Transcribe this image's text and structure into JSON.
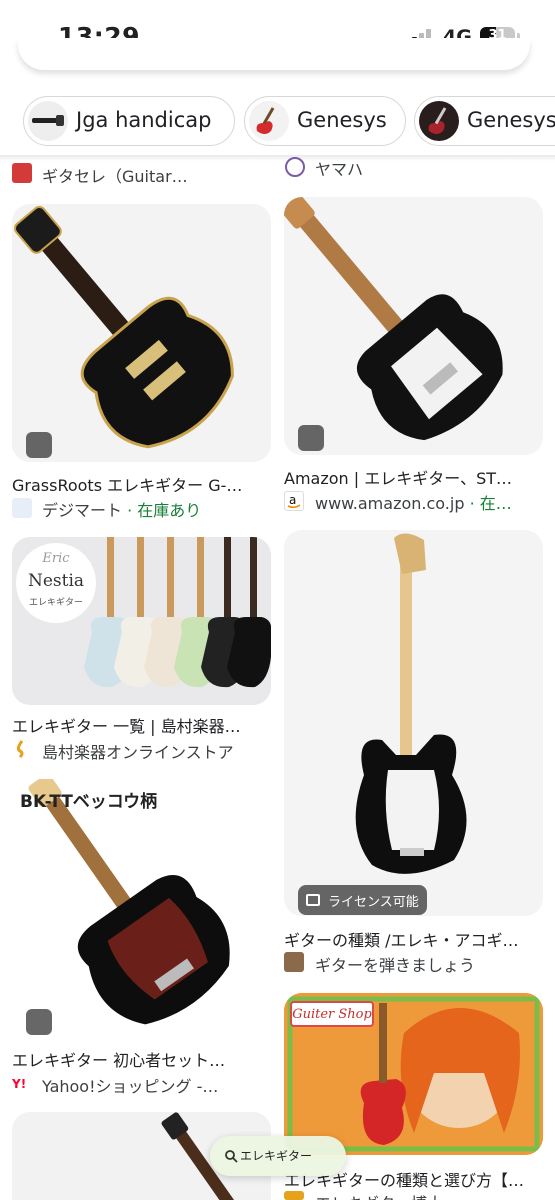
{
  "status": {
    "time": "13:29",
    "network": "4G",
    "battery": "31"
  },
  "chips": [
    {
      "label": "Jga handicap"
    },
    {
      "label": "Genesys"
    },
    {
      "label": "Genesys"
    }
  ],
  "top_partial": {
    "left_source": "ギタセレ（Guitar…",
    "right_source": "ヤマハ"
  },
  "results": [
    {
      "title": "GrassRoots エレキギター G-…",
      "source": "デジマート",
      "stock": "· 在庫あり"
    },
    {
      "title": "Amazon | エレキギター、ST…",
      "source": "www.amazon.co.jp",
      "stock": "· 在…"
    },
    {
      "title": "エレキギター 一覧 | 島村楽器…",
      "source": "島村楽器オンラインストア",
      "overlay_brand": "Eric",
      "overlay_model": "Nestia",
      "overlay_sub": "エレキギター"
    },
    {
      "title": "ギターの種類 /エレキ・アコギ…",
      "source": "ギターを弾きましょう",
      "badge": "ライセンス可能"
    },
    {
      "title": "エレキギター 初心者セット…",
      "source": "Yahoo!ショッピング -…",
      "overlay_text": "BK-TTベッコウ柄"
    },
    {
      "title": "エレキギターの種類と選び方【…",
      "source": "エレキギター博士",
      "overlay_text": "Guiter Shop"
    }
  ],
  "bottom_pill": {
    "label": "エレキギター"
  },
  "colors": {
    "stock_green": "#188038",
    "chip_border": "#d7d7d7"
  }
}
